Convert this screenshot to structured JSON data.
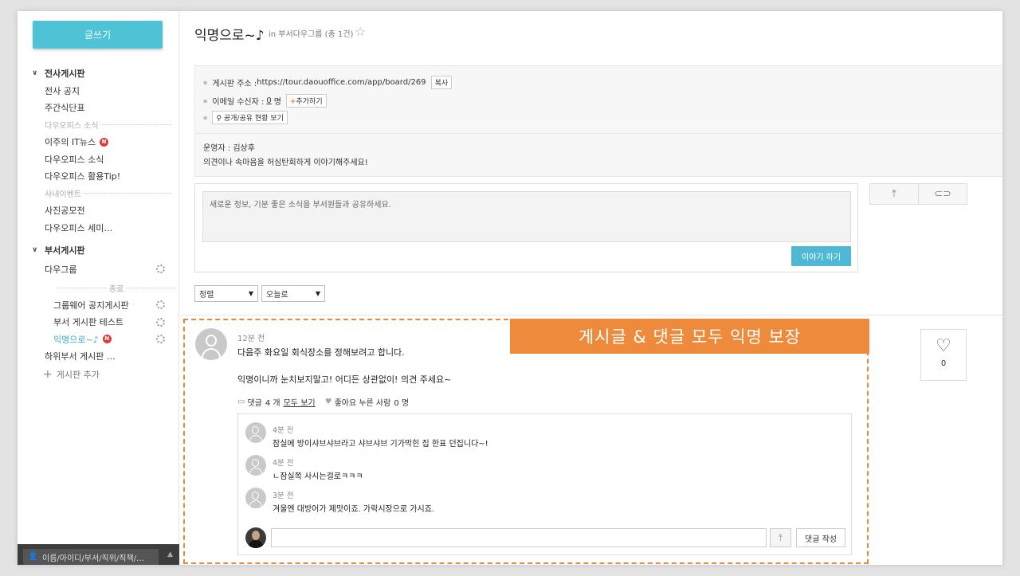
{
  "sidebar": {
    "write_button": "글쓰기",
    "groups": [
      {
        "title": "전사게시판"
      },
      {
        "title": "부서게시판"
      }
    ],
    "company_items": [
      "전사 공지",
      "주간식단표"
    ],
    "divider1": "다우오피스 소식",
    "news_items": [
      "이주의 IT뉴스",
      "다우오피스 소식",
      "다우오피스 활용Tip!"
    ],
    "divider2": "사내이벤트",
    "event_items": [
      "사진공모전",
      "다우오피스 세미…"
    ],
    "dept_item": "다우그룹",
    "divider3": "종료",
    "dept_sub_items": [
      "그룹웨어 공지게시판",
      "부서 게시판 테스트",
      "익명으로~♪"
    ],
    "dept_child": "하위부서 게시판 …",
    "add_board": "게시판 추가",
    "new_badge": "N",
    "search_placeholder": "이름/아이디/부서/직위/직책/…"
  },
  "header": {
    "title": "익명으로~♪",
    "meta": "in 부서다우그룹 (총 1건)"
  },
  "info": {
    "address_label": "게시판 주소 :",
    "address_url": "https://tour.daouoffice.com/app/board/269",
    "copy_button": "복사",
    "email_label": "이메일 수신자 :",
    "email_count": "0",
    "email_unit": "명",
    "add_plus": "+",
    "add_button": "추가하기",
    "share_button": "공개/공유 현황 보기",
    "operator": "운영자 : 김상후",
    "description": "의견이나 속마음을 허심탄회하게 이야기해주세요!"
  },
  "compose": {
    "placeholder": "새로운 정보, 기분 좋은 소식을 부서원들과 공유하세요.",
    "submit": "이야기 하기"
  },
  "filters": {
    "sort": "정렬",
    "date": "오늘로"
  },
  "annotation": "게시글 & 댓글 모두 익명 보장",
  "post": {
    "time": "12분 전",
    "line1": "다음주 화요일 회식장소를 정해보려고 합니다.",
    "line2": "익명이니까 눈치보지말고! 어디든 상관없이! 의견 주세요~",
    "comment_label": "댓글",
    "comment_count": "4 개",
    "view_all": "모두 보기",
    "like_label": "좋아요 누른 사람",
    "like_count": "0 명"
  },
  "comments": [
    {
      "time": "4분 전",
      "text": "잠실에 방이샤브샤브라고 샤브샤브 기가막힌 집 한표 던집니다~!"
    },
    {
      "time": "4분 전",
      "text": "ㄴ잠실쪽 사시는걸로ㅋㅋㅋ"
    },
    {
      "time": "3분 전",
      "text": "겨울엔 대방어가 제맛이죠. 가락시장으로 가시죠."
    }
  ],
  "comment_submit": "댓글 작성",
  "like_box": {
    "count": "0"
  },
  "colors": {
    "accent": "#4fc3d6",
    "annotation": "#ee8a3b",
    "badge": "#e53935"
  }
}
